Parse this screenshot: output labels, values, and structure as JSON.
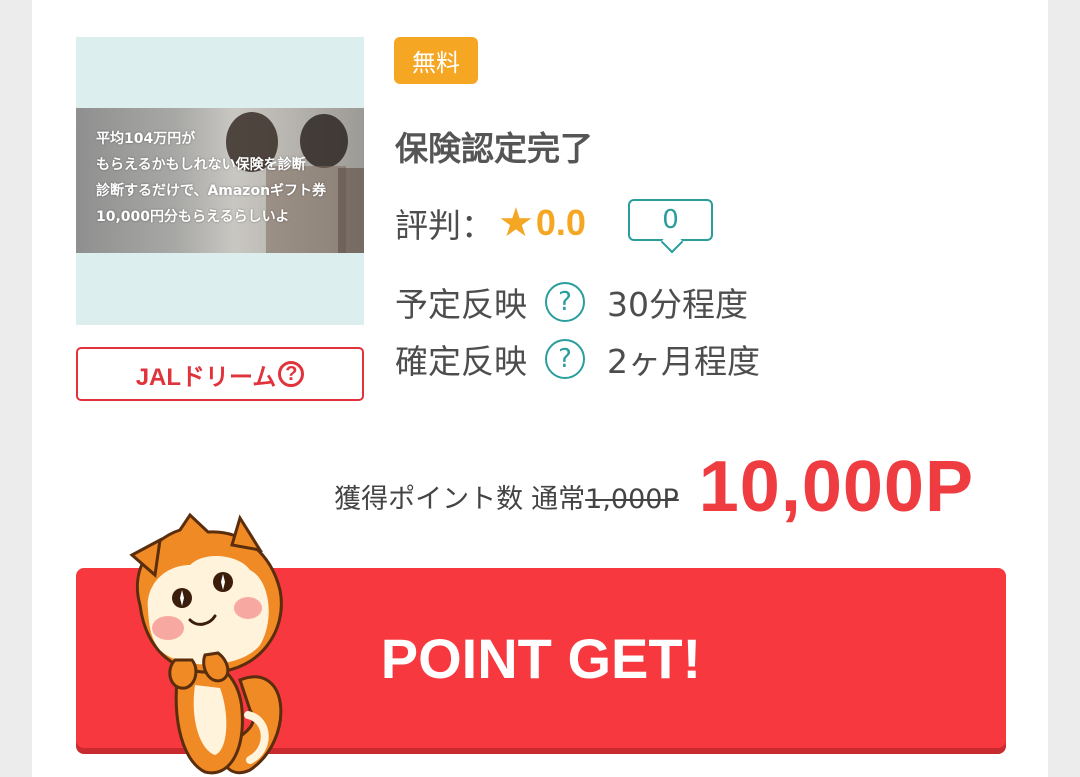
{
  "item": {
    "thumbnail_lines": [
      "平均104万円が",
      "もらえるかもしれない保険を診断",
      "診断するだけで、Amazonギフト券",
      "10,000円分もらえるらしいよ"
    ],
    "tag_label": "JALドリーム",
    "free_badge": "無料",
    "title": "保険認定完了",
    "rating_label": "評判：",
    "rating_score": "0.0",
    "comment_count": "0",
    "info": [
      {
        "label": "予定反映",
        "value": "30分程度"
      },
      {
        "label": "確定反映",
        "value": "2ヶ月程度"
      }
    ],
    "points_label": "獲得ポイント数",
    "normal_label": "通常",
    "normal_points": "1,000P",
    "points": "10,000P"
  },
  "cta": {
    "label": "POINT GET!"
  },
  "colors": {
    "accent_red": "#f7383f",
    "orange": "#f5a623",
    "teal": "#2a9d9d"
  }
}
